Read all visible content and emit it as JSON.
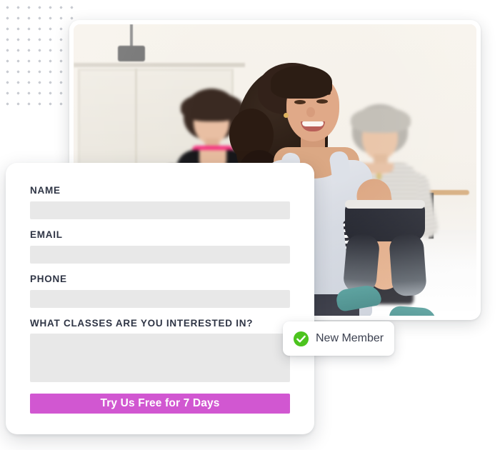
{
  "decoration": {
    "dot_grid": {
      "name": "dot-pattern",
      "dot_color": "#c9ccd2"
    }
  },
  "photo_card": {
    "alt": "Three women dancing in a bright fitness studio",
    "scene": {
      "subject_center": "smiling woman with curly dark hair in grey tank top",
      "subject_left": "woman in black v-neck top with pink sports bra",
      "subject_right": "older woman with grey hair in grey striped top",
      "equipment": "ballet barre and ceiling speaker"
    }
  },
  "form": {
    "fields": [
      {
        "label": "NAME",
        "name": "name-field",
        "value": "",
        "placeholder": ""
      },
      {
        "label": "EMAIL",
        "name": "email-field",
        "value": "",
        "placeholder": ""
      },
      {
        "label": "PHONE",
        "name": "phone-field",
        "value": "",
        "placeholder": ""
      }
    ],
    "interests": {
      "label": "WHAT CLASSES ARE YOU INTERESTED IN?",
      "value": "",
      "placeholder": ""
    },
    "submit_label": "Try Us Free for 7 Days",
    "accent_color": "#d157d1",
    "input_bg": "#e8e8e8",
    "label_color": "#2f3545"
  },
  "badge": {
    "label": "New Member",
    "icon": "check-circle-icon",
    "icon_color": "#4cc41e",
    "text_color": "#3c4150"
  }
}
